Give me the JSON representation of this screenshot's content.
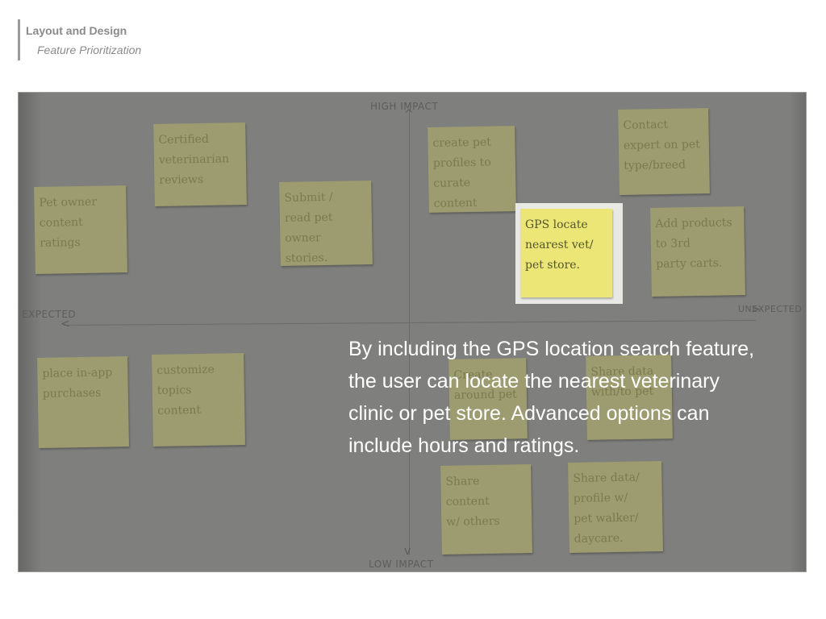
{
  "header": {
    "title": "Layout and Design",
    "subtitle": "Feature Prioritization"
  },
  "board": {
    "axis_top": "HIGH IMPACT",
    "axis_bottom": "LOW IMPACT",
    "axis_left": "EXPECTED",
    "axis_right": "UNEXPECTED",
    "notes": [
      "Certified\nveterinarian\nreviews",
      "Pet owner\ncontent\nratings",
      "Submit /\nread pet\nowner\nstories.",
      "create pet\nprofiles to\ncurate\ncontent",
      "Contact\nexpert on pet\ntype/breed",
      "Add products\nto 3rd\nparty carts.",
      "place in-app\npurchases",
      "customize\ntopics\ncontent",
      "Share data\nwith/to pet",
      "Create\naround pet",
      "Share content\nw/ others",
      "Share data/\nprofile w/\npet walker/\ndaycare."
    ],
    "highlight_note": "GPS locate\nnearest vet/\npet store."
  },
  "caption": "By including the GPS location search feature, the user can locate the nearest veterinary clinic or pet store. Advanced options can include hours and ratings."
}
